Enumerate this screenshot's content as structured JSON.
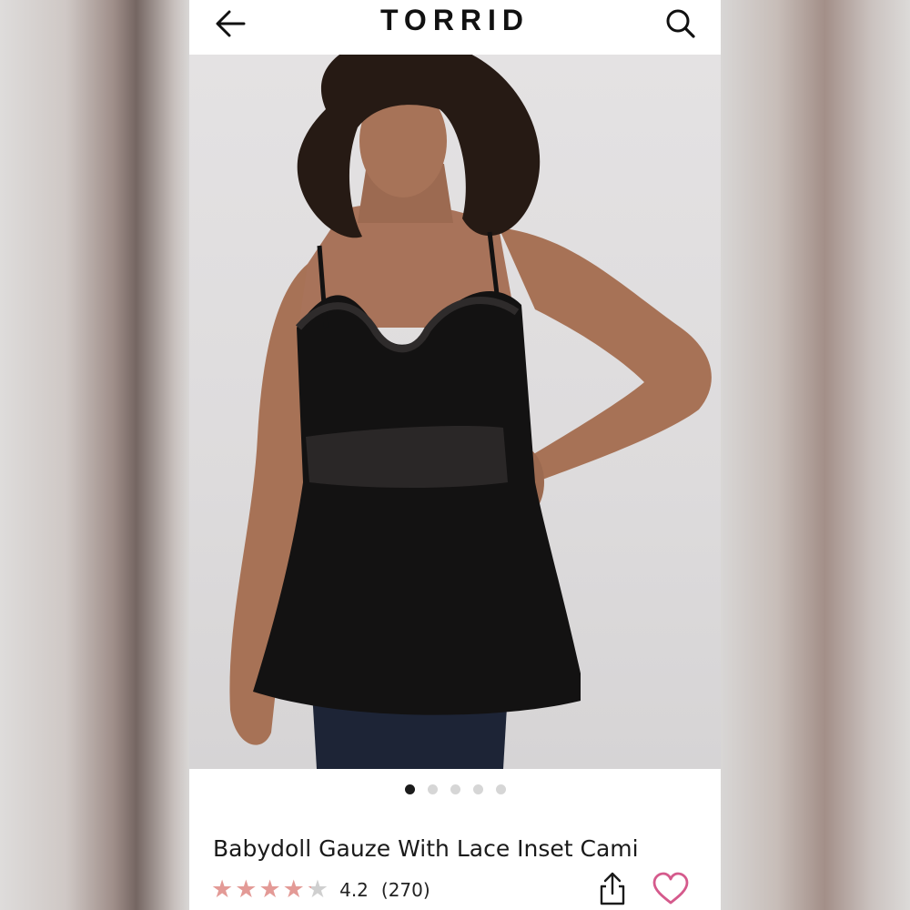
{
  "header": {
    "brand": "TORRID",
    "back_icon": "arrow-left-icon",
    "search_icon": "search-icon"
  },
  "gallery": {
    "image_count": 5,
    "active_index": 0
  },
  "product": {
    "name": "Babydoll Gauze With Lace Inset Cami",
    "rating_value": "4.2",
    "rating_fraction": 0.84,
    "review_count": "(270)",
    "share_icon": "share-icon",
    "wishlist_icon": "heart-outline-icon"
  },
  "colors": {
    "star_filled": "#e39a96",
    "star_empty": "#cfcfcf",
    "heart": "#d55a8c",
    "text": "#1a1a1a"
  }
}
